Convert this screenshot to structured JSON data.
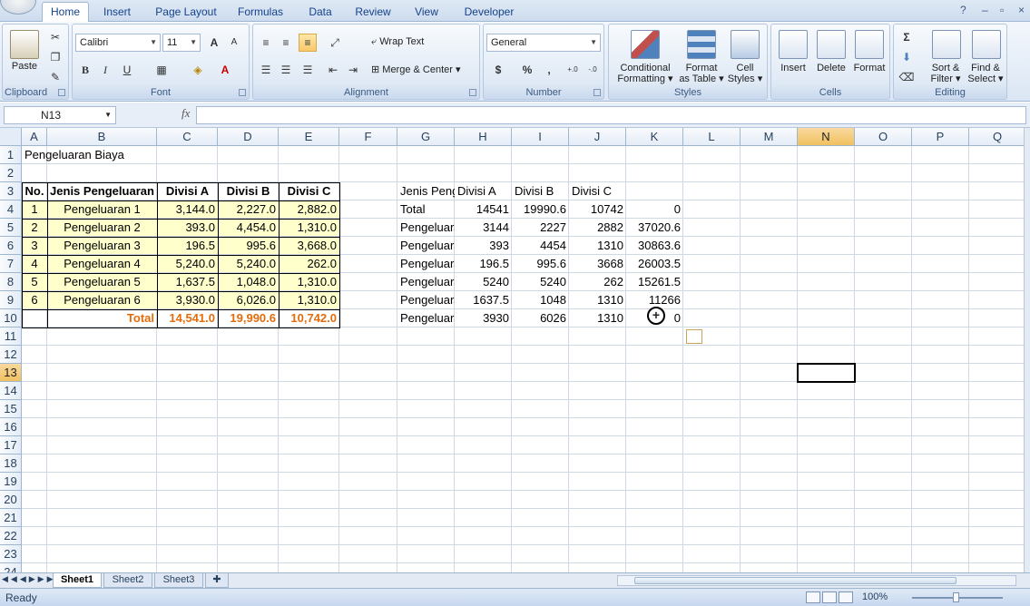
{
  "tabs": [
    "Home",
    "Insert",
    "Page Layout",
    "Formulas",
    "Data",
    "Review",
    "View",
    "Developer"
  ],
  "ribbon": {
    "clipboard": {
      "label": "Clipboard",
      "paste": "Paste"
    },
    "font": {
      "label": "Font",
      "name": "Calibri",
      "size": "11",
      "bold": "B",
      "italic": "I",
      "underline": "U",
      "grow": "A",
      "shrink": "A"
    },
    "alignment": {
      "label": "Alignment",
      "wrap": "Wrap Text",
      "merge": "Merge & Center"
    },
    "number": {
      "label": "Number",
      "format": "General",
      "currency": "$",
      "percent": "%",
      "comma": ",",
      "inc_dec": "←.0 .00",
      "dec_dec": ".00 →.0"
    },
    "styles": {
      "label": "Styles",
      "conditional": [
        "Conditional",
        "Formatting"
      ],
      "format_table": [
        "Format",
        "as Table"
      ],
      "cell_styles": [
        "Cell",
        "Styles"
      ]
    },
    "cells": {
      "label": "Cells",
      "insert": "Insert",
      "delete": "Delete",
      "format": "Format"
    },
    "editing": {
      "label": "Editing",
      "sort": [
        "Sort &",
        "Filter"
      ],
      "find": [
        "Find &",
        "Select"
      ],
      "sigma": "Σ"
    }
  },
  "formula_bar": {
    "name_box": "N13",
    "fx": "fx",
    "content": ""
  },
  "columns": [
    "A",
    "B",
    "C",
    "D",
    "E",
    "F",
    "G",
    "H",
    "I",
    "J",
    "K",
    "L",
    "M",
    "N",
    "O",
    "P",
    "Q"
  ],
  "rows": [
    "1",
    "2",
    "3",
    "4",
    "5",
    "6",
    "7",
    "8",
    "9",
    "10",
    "11",
    "12",
    "13",
    "14",
    "15",
    "16",
    "17",
    "18",
    "19",
    "20",
    "21",
    "22",
    "23",
    "24"
  ],
  "cells": {
    "A1": "Pengeluaran Biaya",
    "A3": "No.",
    "B3": "Jenis Pengeluaran",
    "C3": "Divisi A",
    "D3": "Divisi B",
    "E3": "Divisi C",
    "A4": "1",
    "B4": "Pengeluaran 1",
    "C4": "3,144.0",
    "D4": "2,227.0",
    "E4": "2,882.0",
    "A5": "2",
    "B5": "Pengeluaran 2",
    "C5": "393.0",
    "D5": "4,454.0",
    "E5": "1,310.0",
    "A6": "3",
    "B6": "Pengeluaran 3",
    "C6": "196.5",
    "D6": "995.6",
    "E6": "3,668.0",
    "A7": "4",
    "B7": "Pengeluaran 4",
    "C7": "5,240.0",
    "D7": "5,240.0",
    "E7": "262.0",
    "A8": "5",
    "B8": "Pengeluaran 5",
    "C8": "1,637.5",
    "D8": "1,048.0",
    "E8": "1,310.0",
    "A9": "6",
    "B9": "Pengeluaran 6",
    "C9": "3,930.0",
    "D9": "6,026.0",
    "E9": "1,310.0",
    "B10": "Total",
    "C10": "14,541.0",
    "D10": "19,990.6",
    "E10": "10,742.0",
    "G3": "Jenis Peng",
    "H3": "Divisi A",
    "I3": "Divisi B",
    "J3": "Divisi C",
    "G4": "Total",
    "H4": "14541",
    "I4": "19990.6",
    "J4": "10742",
    "K4": "0",
    "G5": "Pengeluaran",
    "H5": "3144",
    "I5": "2227",
    "J5": "2882",
    "K5": "37020.6",
    "G6": "Pengeluaran",
    "H6": "393",
    "I6": "4454",
    "J6": "1310",
    "K6": "30863.6",
    "G7": "Pengeluaran",
    "H7": "196.5",
    "I7": "995.6",
    "J7": "3668",
    "K7": "26003.5",
    "G8": "Pengeluaran",
    "H8": "5240",
    "I8": "5240",
    "J8": "262",
    "K8": "15261.5",
    "G9": "Pengeluaran",
    "H9": "1637.5",
    "I9": "1048",
    "J9": "1310",
    "K9": "11266",
    "G10": "Pengeluaran",
    "H10": "3930",
    "I10": "6026",
    "J10": "1310",
    "K10": "0"
  },
  "sheets": [
    "Sheet1",
    "Sheet2",
    "Sheet3"
  ],
  "status": {
    "text": "Ready",
    "zoom": "100%"
  },
  "colors": {
    "accent_orange": "#e46c0a",
    "table_fill": "#ffffcc",
    "ribbon_text": "#15428b"
  }
}
